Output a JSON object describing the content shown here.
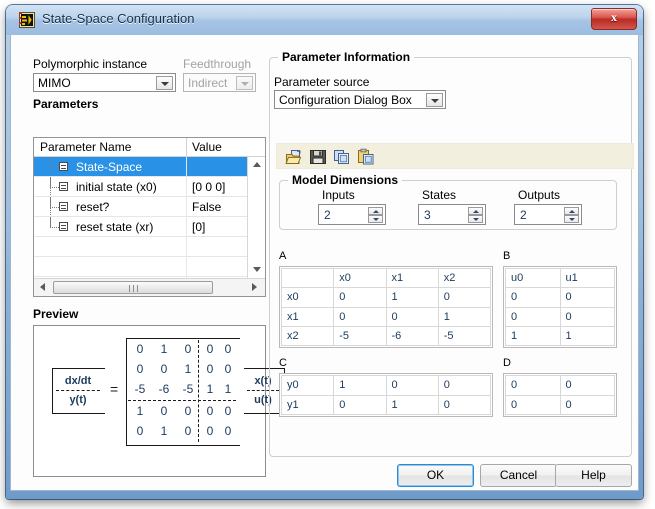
{
  "window": {
    "title": "State-Space Configuration",
    "icon": "labview-icon",
    "close_label": "x"
  },
  "left": {
    "polymorphic_label": "Polymorphic instance",
    "polymorphic_value": "MIMO",
    "feedthrough_label": "Feedthrough",
    "feedthrough_value": "Indirect",
    "parameters_label": "Parameters",
    "columns": [
      "Parameter Name",
      "Value"
    ],
    "rows": [
      {
        "name": "State-Space",
        "value": "",
        "selected": true
      },
      {
        "name": "initial state (x0)",
        "value": "[0 0 0]",
        "selected": false
      },
      {
        "name": "reset?",
        "value": "False",
        "selected": false
      },
      {
        "name": "reset state (xr)",
        "value": "[0]",
        "selected": false
      }
    ],
    "preview_label": "Preview"
  },
  "preview": {
    "lhs_top": "dx/dt",
    "lhs_bottom": "y(t)",
    "equals": "=",
    "rhs_top": "x(t)",
    "rhs_bottom": "u(t)",
    "matrix": [
      [
        "0",
        "1",
        "0",
        "0",
        "0"
      ],
      [
        "0",
        "0",
        "1",
        "0",
        "0"
      ],
      [
        "-5",
        "-6",
        "-5",
        "1",
        "1"
      ],
      [
        "1",
        "0",
        "0",
        "0",
        "0"
      ],
      [
        "0",
        "1",
        "0",
        "0",
        "0"
      ]
    ],
    "split_row": 3,
    "split_col": 3
  },
  "right": {
    "group_title": "Parameter Information",
    "param_source_label": "Parameter source",
    "param_source_value": "Configuration Dialog Box",
    "toolbar": [
      {
        "name": "open-icon",
        "tip": "Open"
      },
      {
        "name": "save-icon",
        "tip": "Save"
      },
      {
        "name": "copy-icon",
        "tip": "Copy"
      },
      {
        "name": "paste-icon",
        "tip": "Paste"
      }
    ],
    "model_dimensions": {
      "title": "Model Dimensions",
      "fields": [
        {
          "label": "Inputs",
          "value": "2"
        },
        {
          "label": "States",
          "value": "3"
        },
        {
          "label": "Outputs",
          "value": "2"
        }
      ]
    },
    "matrices": [
      {
        "label": "A",
        "col_headers": [
          "",
          "x0",
          "x1",
          "x2"
        ],
        "rows": [
          [
            "x0",
            "0",
            "1",
            "0"
          ],
          [
            "x1",
            "0",
            "0",
            "1"
          ],
          [
            "x2",
            "-5",
            "-6",
            "-5"
          ]
        ]
      },
      {
        "label": "B",
        "col_headers": [
          "u0",
          "u1"
        ],
        "rows": [
          [
            "0",
            "0"
          ],
          [
            "0",
            "0"
          ],
          [
            "1",
            "1"
          ]
        ]
      },
      {
        "label": "C",
        "col_headers": [],
        "rows": [
          [
            "y0",
            "1",
            "0",
            "0"
          ],
          [
            "y1",
            "0",
            "1",
            "0"
          ]
        ]
      },
      {
        "label": "D",
        "col_headers": [],
        "rows": [
          [
            "0",
            "0"
          ],
          [
            "0",
            "0"
          ]
        ]
      }
    ]
  },
  "buttons": {
    "ok": "OK",
    "cancel": "Cancel",
    "help": "Help"
  }
}
